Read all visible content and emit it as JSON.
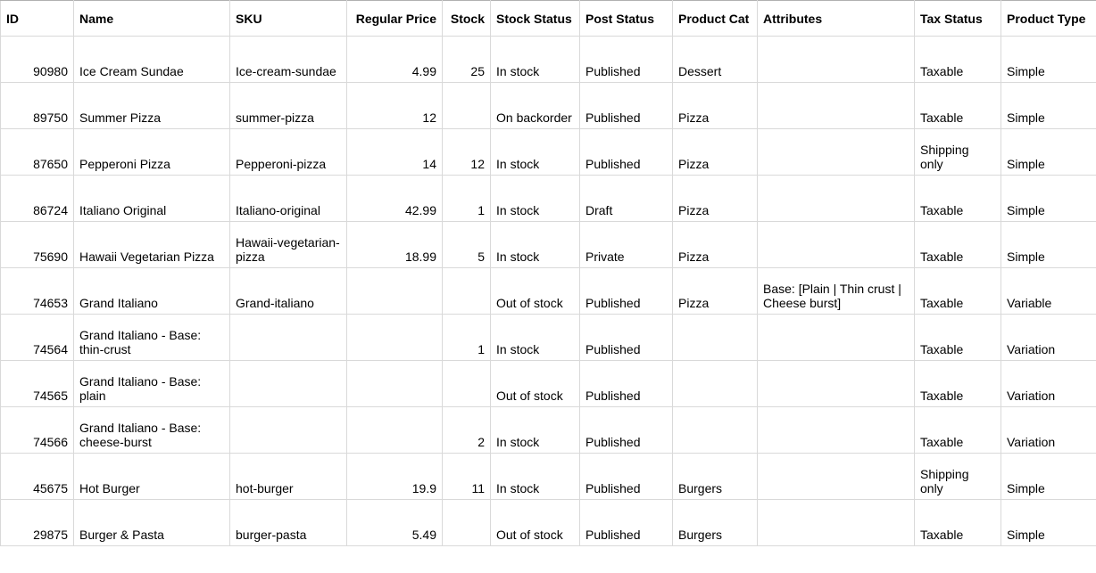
{
  "headers": {
    "id": "ID",
    "name": "Name",
    "sku": "SKU",
    "regular_price": "Regular Price",
    "stock": "Stock",
    "stock_status": "Stock Status",
    "post_status": "Post Status",
    "product_cat": "Product Cat",
    "attributes": "Attributes",
    "tax_status": "Tax Status",
    "product_type": "Product Type"
  },
  "rows": [
    {
      "id": "90980",
      "name": "Ice Cream Sundae",
      "sku": "Ice-cream-sundae",
      "regular_price": "4.99",
      "stock": "25",
      "stock_status": "In stock",
      "post_status": "Published",
      "product_cat": "Dessert",
      "attributes": "",
      "tax_status": "Taxable",
      "product_type": "Simple"
    },
    {
      "id": "89750",
      "name": "Summer Pizza",
      "sku": "summer-pizza",
      "regular_price": "12",
      "stock": "",
      "stock_status": "On backorder",
      "post_status": "Published",
      "product_cat": "Pizza",
      "attributes": "",
      "tax_status": "Taxable",
      "product_type": "Simple"
    },
    {
      "id": "87650",
      "name": "Pepperoni Pizza",
      "sku": "Pepperoni-pizza",
      "regular_price": "14",
      "stock": "12",
      "stock_status": "In stock",
      "post_status": "Published",
      "product_cat": "Pizza",
      "attributes": "",
      "tax_status": "Shipping only",
      "product_type": "Simple"
    },
    {
      "id": "86724",
      "name": "Italiano Original",
      "sku": "Italiano-original",
      "regular_price": "42.99",
      "stock": "1",
      "stock_status": "In stock",
      "post_status": "Draft",
      "product_cat": "Pizza",
      "attributes": "",
      "tax_status": "Taxable",
      "product_type": "Simple"
    },
    {
      "id": "75690",
      "name": "Hawaii Vegetarian Pizza",
      "sku": "Hawaii-vegetarian-pizza",
      "regular_price": "18.99",
      "stock": "5",
      "stock_status": "In stock",
      "post_status": "Private",
      "product_cat": "Pizza",
      "attributes": "",
      "tax_status": "Taxable",
      "product_type": "Simple"
    },
    {
      "id": "74653",
      "name": "Grand Italiano",
      "sku": "Grand-italiano",
      "regular_price": "",
      "stock": "",
      "stock_status": "Out of stock",
      "post_status": "Published",
      "product_cat": "Pizza",
      "attributes": "Base: [Plain | Thin crust | Cheese burst]",
      "tax_status": "Taxable",
      "product_type": "Variable"
    },
    {
      "id": "74564",
      "name": "Grand Italiano - Base: thin-crust",
      "sku": "",
      "regular_price": "",
      "stock": "1",
      "stock_status": "In stock",
      "post_status": "Published",
      "product_cat": "",
      "attributes": "",
      "tax_status": "Taxable",
      "product_type": "Variation"
    },
    {
      "id": "74565",
      "name": "Grand Italiano - Base: plain",
      "sku": "",
      "regular_price": "",
      "stock": "",
      "stock_status": "Out of stock",
      "post_status": "Published",
      "product_cat": "",
      "attributes": "",
      "tax_status": "Taxable",
      "product_type": "Variation"
    },
    {
      "id": "74566",
      "name": "Grand Italiano - Base: cheese-burst",
      "sku": "",
      "regular_price": "",
      "stock": "2",
      "stock_status": "In stock",
      "post_status": "Published",
      "product_cat": "",
      "attributes": "",
      "tax_status": "Taxable",
      "product_type": "Variation"
    },
    {
      "id": "45675",
      "name": "Hot Burger",
      "sku": "hot-burger",
      "regular_price": "19.9",
      "stock": "11",
      "stock_status": "In stock",
      "post_status": "Published",
      "product_cat": "Burgers",
      "attributes": "",
      "tax_status": "Shipping only",
      "product_type": "Simple"
    },
    {
      "id": "29875",
      "name": "Burger & Pasta",
      "sku": "burger-pasta",
      "regular_price": "5.49",
      "stock": "",
      "stock_status": "Out of stock",
      "post_status": "Published",
      "product_cat": "Burgers",
      "attributes": "",
      "tax_status": "Taxable",
      "product_type": "Simple"
    }
  ]
}
